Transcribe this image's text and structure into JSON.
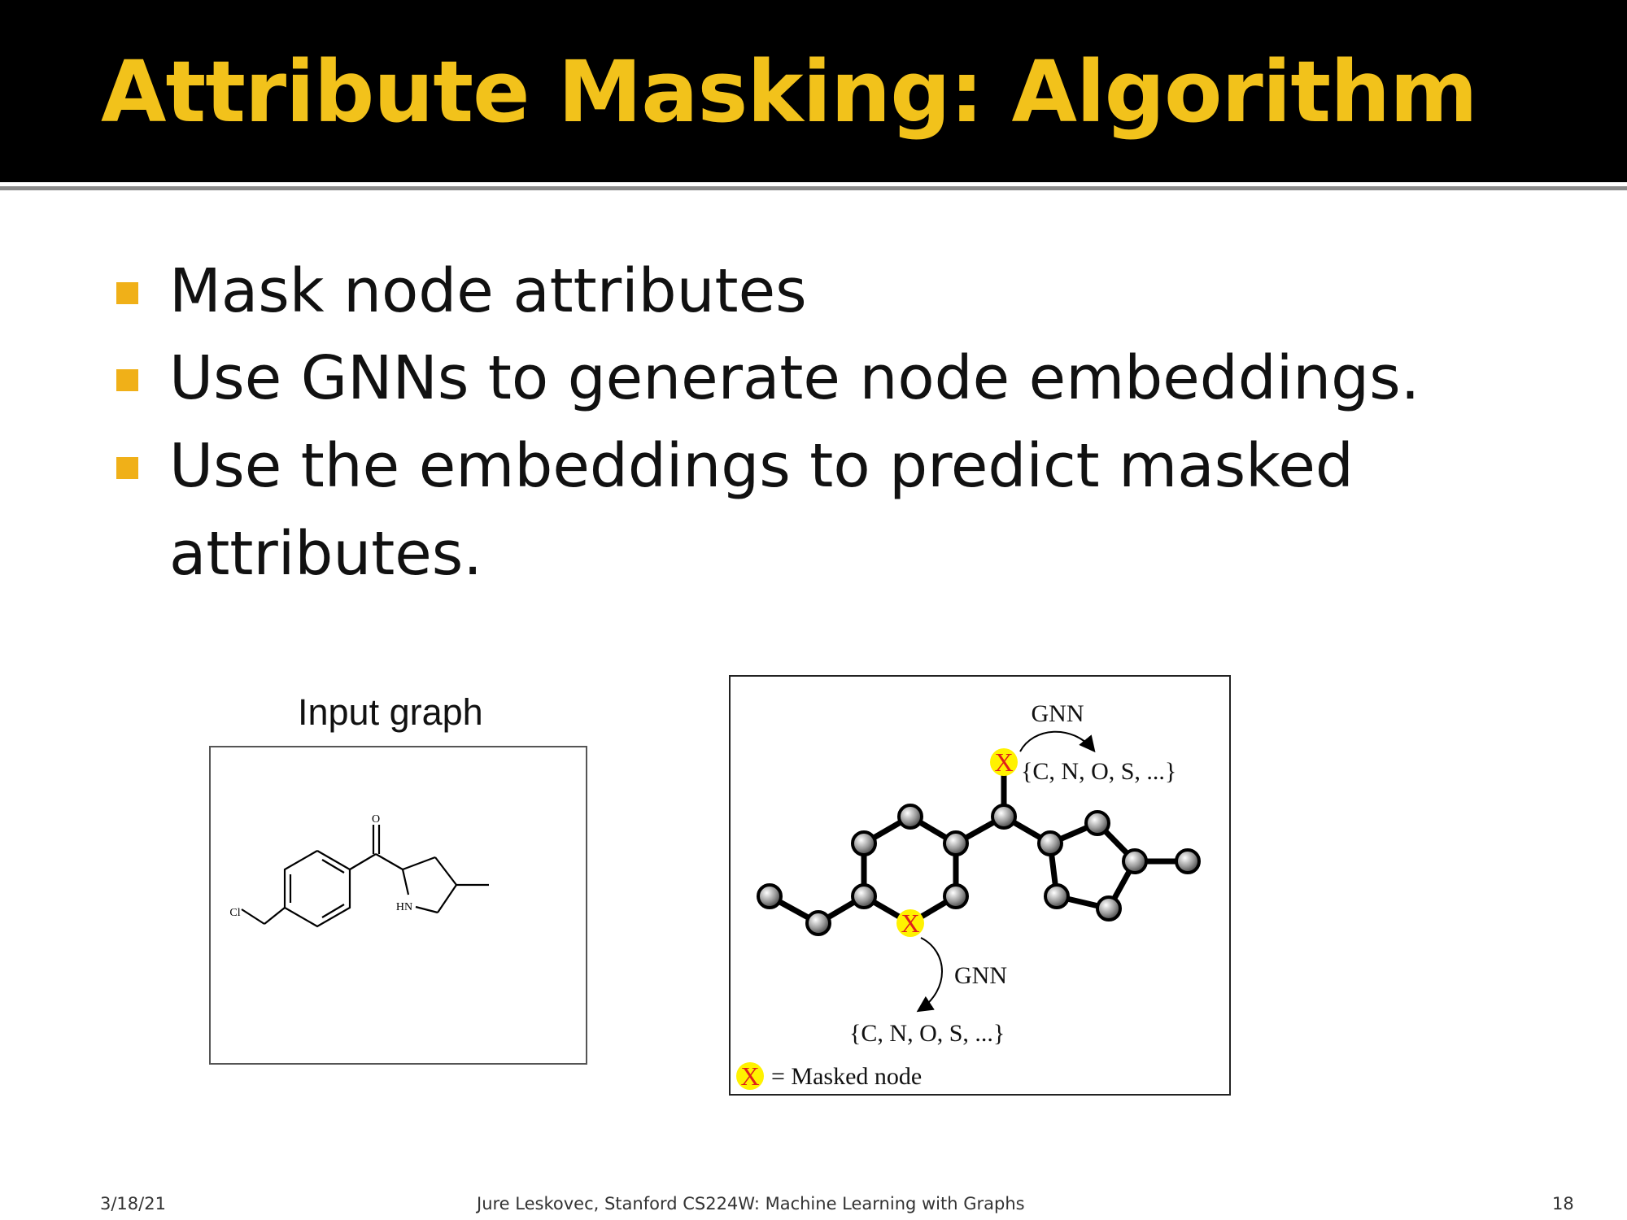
{
  "slide": {
    "title": "Attribute Masking: Algorithm",
    "bullets": [
      "Mask node attributes",
      "Use GNNs to generate node embeddings.",
      "Use the embeddings to predict masked attributes."
    ]
  },
  "figure_left": {
    "title": "Input graph",
    "atom_labels": {
      "oxygen": "O",
      "chlorine": "Cl",
      "nitrogen": "HN"
    }
  },
  "figure_right": {
    "gnn_label_top": "GNN",
    "gnn_label_bottom": "GNN",
    "prediction_set_top": "{C, N, O, S, ...}",
    "prediction_set_bottom": "{C, N, O, S, ...}",
    "mask_symbol": "X",
    "legend_text": "=  Masked node"
  },
  "footer": {
    "date": "3/18/21",
    "credit": "Jure Leskovec, Stanford CS224W: Machine Learning with Graphs",
    "page_number": "18"
  },
  "colors": {
    "title_text": "#f2c21b",
    "bullet_marker": "#f0b018",
    "mask_highlight": "#fff200",
    "mask_x": "#e0201b"
  }
}
